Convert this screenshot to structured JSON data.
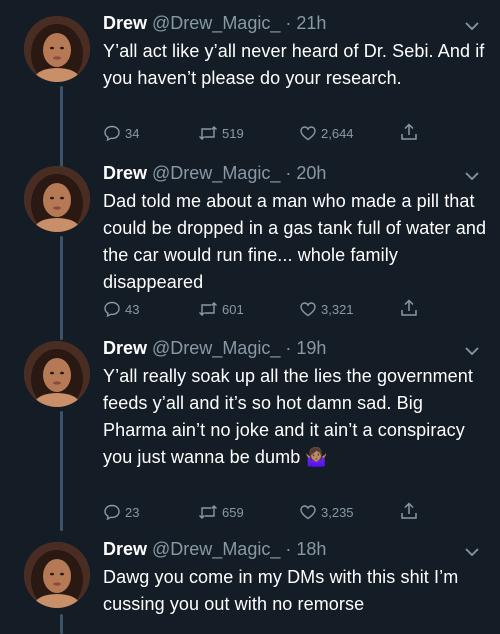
{
  "tweets": [
    {
      "name": "Drew",
      "handle": "@Drew_Magic_",
      "time": "· 21h",
      "text": "Y’all act like y’all never heard of Dr. Sebi. And if you haven’t please do your research.",
      "replies": "34",
      "retweets": "519",
      "likes": "2,644"
    },
    {
      "name": "Drew",
      "handle": "@Drew_Magic_",
      "time": "· 20h",
      "text": "Dad told me about a man who made a pill that could be dropped in a gas tank full of water and the car would run fine... whole family disappeared",
      "replies": "43",
      "retweets": "601",
      "likes": "3,321"
    },
    {
      "name": "Drew",
      "handle": "@Drew_Magic_",
      "time": "· 19h",
      "text": "Y’all really soak up all the lies the government feeds y’all and it’s so hot damn sad. Big Pharma ain’t no joke and it ain’t a conspiracy you just wanna be dumb 🤷🏽‍♀️",
      "replies": "23",
      "retweets": "659",
      "likes": "3,235"
    },
    {
      "name": "Drew",
      "handle": "@Drew_Magic_",
      "time": "· 18h",
      "text": "Dawg you come in my DMs with this shit I’m cussing you out with no remorse"
    }
  ],
  "colors": {
    "background": "#141d26",
    "muted": "#8899a6",
    "thread_line": "#3d5466"
  }
}
